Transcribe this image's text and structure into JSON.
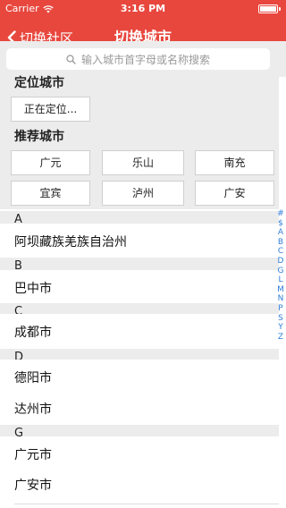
{
  "status_bar": {
    "carrier": "Carrier",
    "time": "3:16 PM"
  },
  "nav": {
    "back_label": "切换社区",
    "title": "切换城市"
  },
  "search": {
    "placeholder": "输入城市首字母或名称搜索"
  },
  "locate": {
    "header": "定位城市",
    "button": "正在定位..."
  },
  "recommend": {
    "header": "推荐城市",
    "cities": [
      "广元",
      "乐山",
      "南充",
      "宜宾",
      "泸州",
      "广安"
    ]
  },
  "list": {
    "sections": [
      {
        "letter": "A",
        "cities": [
          "阿坝藏族羌族自治州"
        ]
      },
      {
        "letter": "B",
        "cities": [
          "巴中市"
        ]
      },
      {
        "letter": "C",
        "cities": [
          "成都市"
        ]
      },
      {
        "letter": "D",
        "cities": [
          "德阳市",
          "达州市"
        ]
      },
      {
        "letter": "G",
        "cities": [
          "广元市",
          "广安市"
        ]
      }
    ]
  },
  "index_letters": [
    "#",
    "$",
    "A",
    "B",
    "C",
    "D",
    "G",
    "L",
    "M",
    "N",
    "P",
    "S",
    "Y",
    "Z"
  ],
  "colors": {
    "brand": "#e8473e",
    "index": "#2f7ed8"
  }
}
